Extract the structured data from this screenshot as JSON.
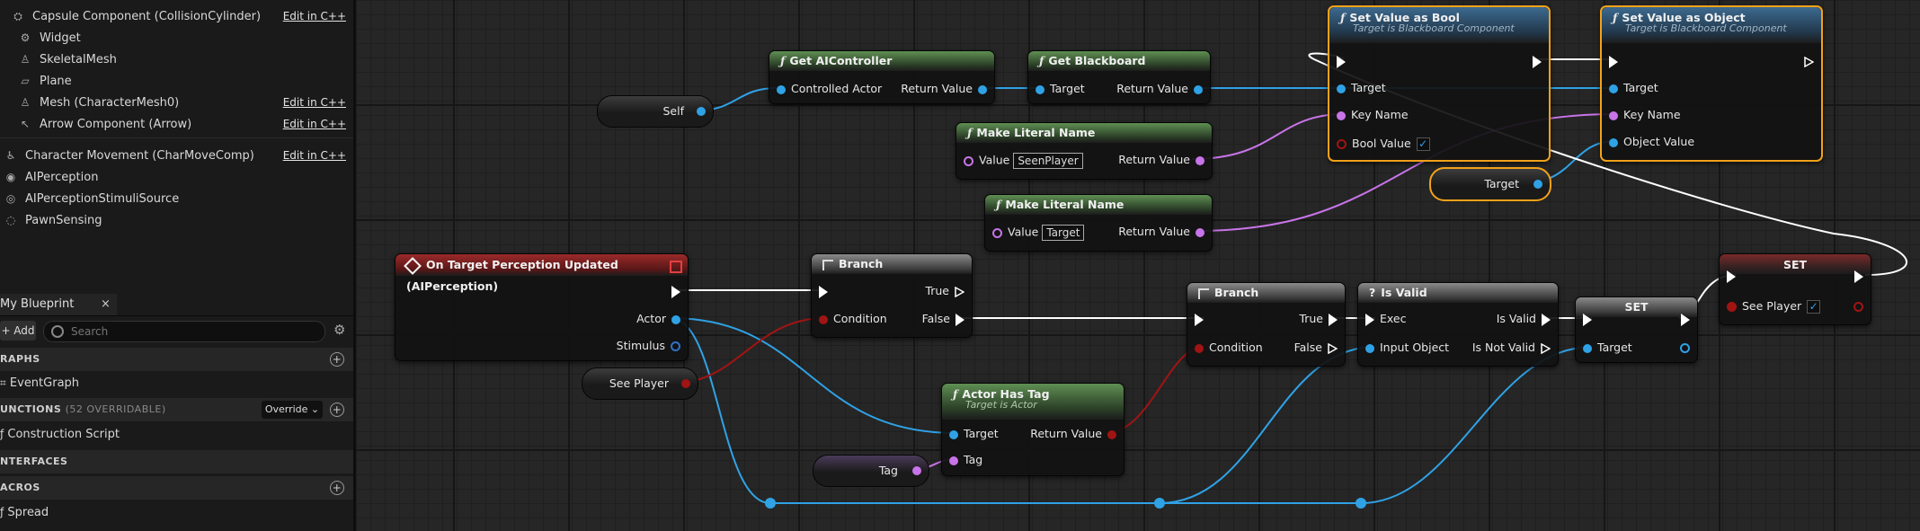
{
  "components": [
    {
      "label": "Capsule Component (CollisionCylinder)",
      "edit": "Edit in C++",
      "icon": "capsule-icon"
    },
    {
      "label": "Widget",
      "edit": "",
      "icon": "widget-icon"
    },
    {
      "label": "SkeletalMesh",
      "edit": "",
      "icon": "skeletal-mesh-icon"
    },
    {
      "label": "Plane",
      "edit": "",
      "icon": "plane-mesh-icon"
    },
    {
      "label": "Mesh (CharacterMesh0)",
      "edit": "Edit in C++",
      "icon": "character-mesh-icon"
    },
    {
      "label": "Arrow Component (Arrow)",
      "edit": "Edit in C++",
      "icon": "arrow-icon"
    },
    {
      "label": "Character Movement (CharMoveComp)",
      "edit": "Edit in C++",
      "icon": "movement-icon"
    },
    {
      "label": "AIPerception",
      "edit": "",
      "icon": "perception-icon"
    },
    {
      "label": "AIPerceptionStimuliSource",
      "edit": "",
      "icon": "stimuli-icon"
    },
    {
      "label": "PawnSensing",
      "edit": "",
      "icon": "pawn-sensing-icon"
    }
  ],
  "mybp": {
    "tab": "My Blueprint",
    "close": "×",
    "add": "+ Add",
    "search_placeholder": "Search",
    "graphs_hdr": "RAPHS",
    "graph_item": "EventGraph",
    "functions_hdr": "UNCTIONS",
    "functions_count": "(52 OVERRIDABLE)",
    "override": "Override ⌄",
    "function_item": "Construction Script",
    "interfaces_hdr": "NTERFACES",
    "macros_hdr": "ACROS",
    "macro_item": "Spread"
  },
  "nodes": {
    "self": "Self",
    "get_ai": {
      "title": "Get AIController",
      "in": "Controlled Actor",
      "out": "Return Value"
    },
    "get_bb": {
      "title": "Get Blackboard",
      "in": "Target",
      "out": "Return Value"
    },
    "lit1": {
      "title": "Make Literal Name",
      "in": "Value",
      "value": "SeenPlayer",
      "out": "Return Value"
    },
    "lit2": {
      "title": "Make Literal Name",
      "in": "Value",
      "value": "Target",
      "out": "Return Value"
    },
    "setbool": {
      "title": "Set Value as Bool",
      "sub": "Target is Blackboard Component",
      "p1": "Target",
      "p2": "Key Name",
      "p3": "Bool Value",
      "check": "✓"
    },
    "setobj": {
      "title": "Set Value as Object",
      "sub": "Target is Blackboard Component",
      "p1": "Target",
      "p2": "Key Name",
      "p3": "Object Value"
    },
    "target_var": "Target",
    "event": {
      "title": "On Target Perception Updated (AIPerception)",
      "p1": "Actor",
      "p2": "Stimulus"
    },
    "see_var": "See Player",
    "branch1": {
      "title": "Branch",
      "in": "Condition",
      "t": "True",
      "f": "False"
    },
    "branch2": {
      "title": "Branch",
      "in": "Condition",
      "t": "True",
      "f": "False"
    },
    "isvalid": {
      "title": "Is Valid",
      "in1": "Exec",
      "in2": "Input Object",
      "o1": "Is Valid",
      "o2": "Is Not Valid"
    },
    "set1": {
      "title": "SET",
      "pin": "Target"
    },
    "set2": {
      "title": "SET",
      "pin": "See Player",
      "check": "✓"
    },
    "hastag": {
      "title": "Actor Has Tag",
      "sub": "Target is Actor",
      "p1": "Target",
      "p2": "Tag",
      "out": "Return Value"
    },
    "tag_var": "Tag"
  },
  "colors": {
    "object": "#2fa2e6",
    "name": "#c774e8",
    "bool": "#a11414",
    "exec": "#ffffff",
    "selected": "#f3a21a"
  }
}
